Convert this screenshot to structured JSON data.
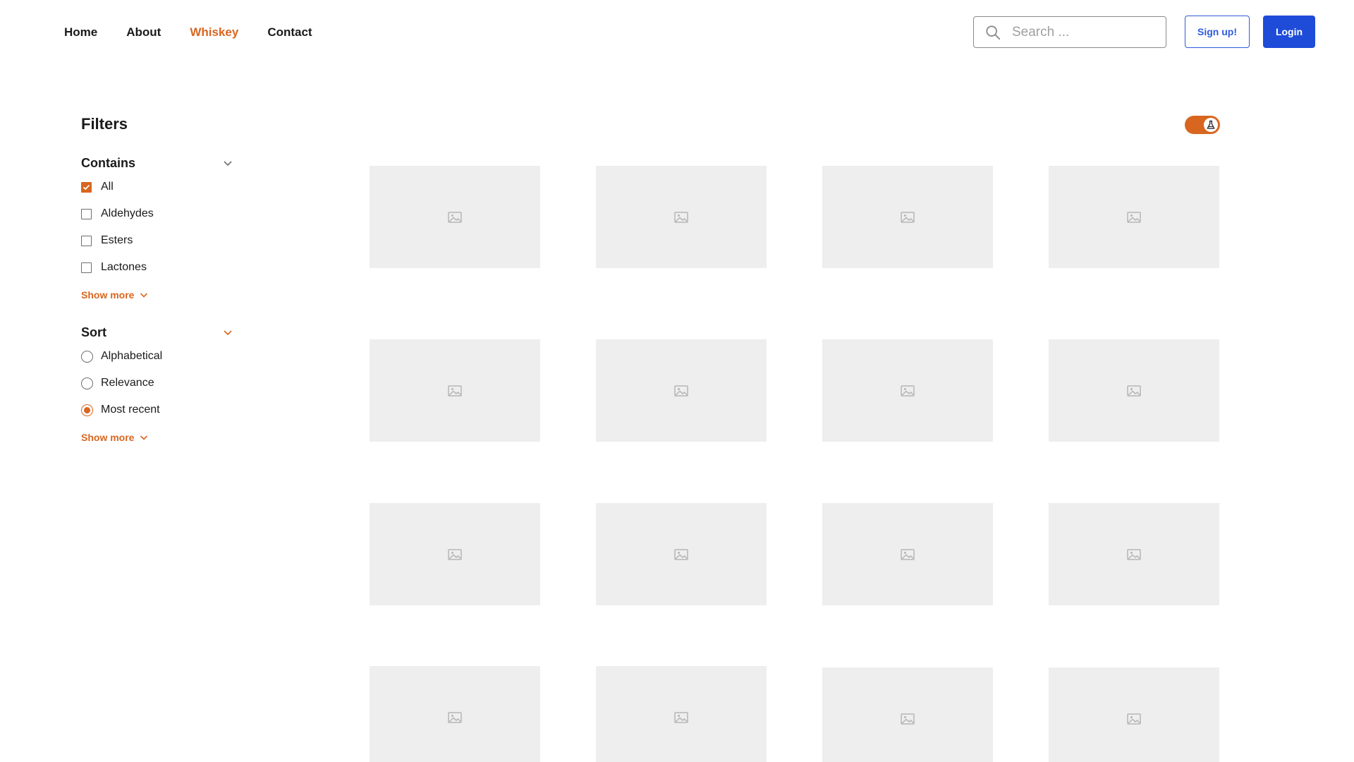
{
  "nav": {
    "links": [
      {
        "label": "Home",
        "active": false
      },
      {
        "label": "About",
        "active": false
      },
      {
        "label": "Whiskey",
        "active": true
      },
      {
        "label": "Contact",
        "active": false
      }
    ],
    "search_placeholder": "Search ...",
    "signup_label": "Sign up!",
    "login_label": "Login"
  },
  "sidebar": {
    "title": "Filters",
    "contains": {
      "title": "Contains",
      "options": [
        {
          "label": "All",
          "checked": true
        },
        {
          "label": "Aldehydes",
          "checked": false
        },
        {
          "label": "Esters",
          "checked": false
        },
        {
          "label": "Lactones",
          "checked": false
        }
      ],
      "show_more": "Show more"
    },
    "sort": {
      "title": "Sort",
      "options": [
        {
          "label": "Alphabetical",
          "selected": false
        },
        {
          "label": "Relevance",
          "selected": false
        },
        {
          "label": "Most recent",
          "selected": true
        }
      ],
      "show_more": "Show more"
    }
  },
  "toggle": {
    "on": true,
    "icon": "flask-icon"
  },
  "colors": {
    "accent": "#D9661F",
    "primary": "#1E4BD8",
    "placeholder_bg": "#EEEEEE"
  },
  "grid": {
    "rows": 4,
    "columns": 4,
    "item_icon": "image-placeholder-icon"
  }
}
